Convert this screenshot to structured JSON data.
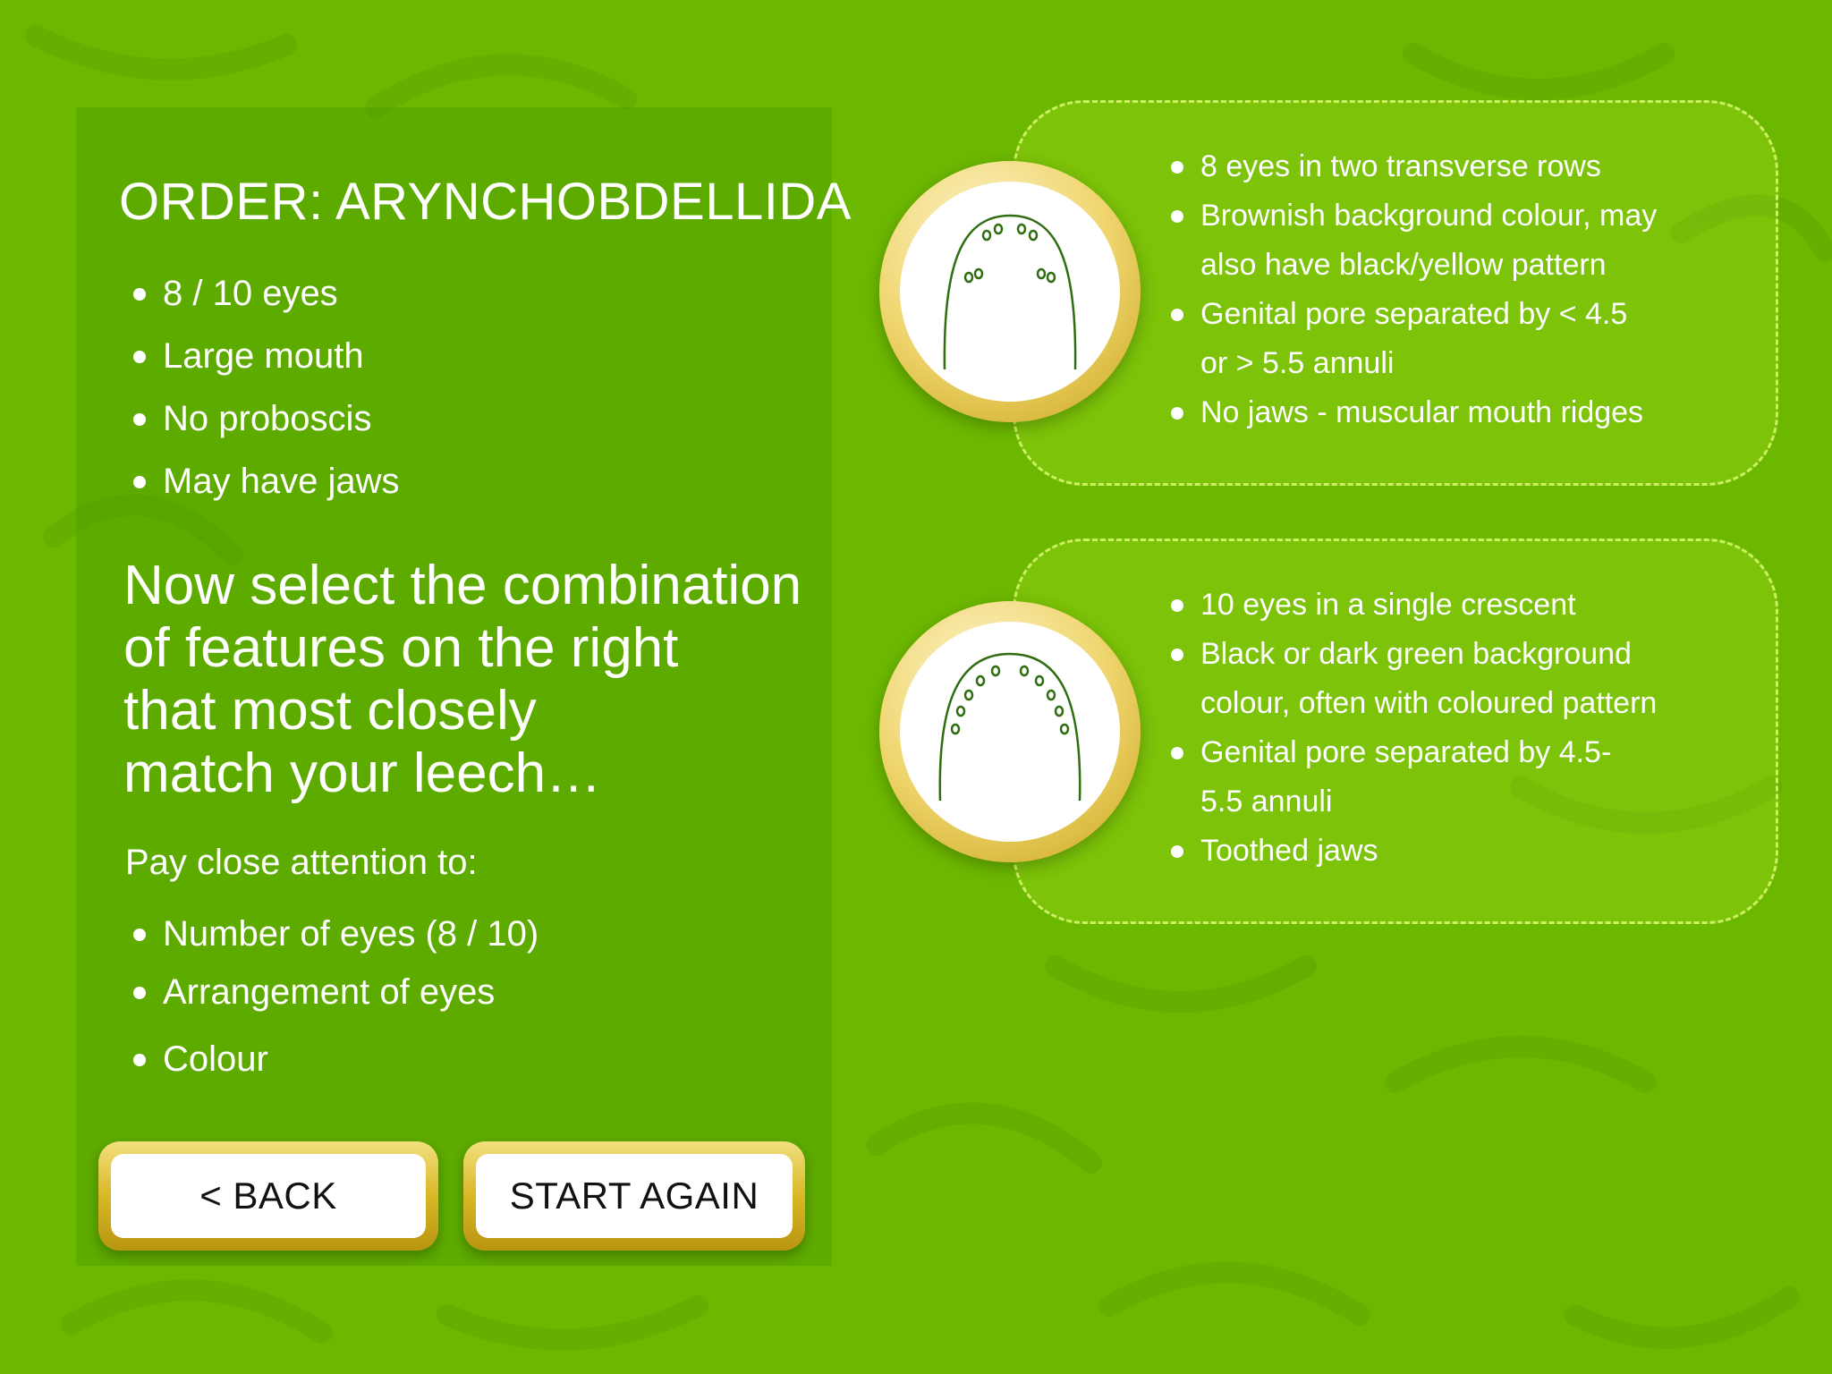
{
  "colors": {
    "background": "#6cb800",
    "left_panel": "#5aa300",
    "text": "#ffffff",
    "button_rim": "#d9b826",
    "button_face": "#ffffff",
    "option_border": "#d4f56e",
    "eye_line": "#2f6e10"
  },
  "order": {
    "title": "ORDER: ARYNCHOBDELLIDA",
    "features": [
      "8 / 10 eyes",
      "Large mouth",
      "No proboscis",
      "May have jaws"
    ]
  },
  "instruction": {
    "lines": [
      "Now select the combination",
      "of features on the right",
      "that most closely",
      "match your leech…"
    ]
  },
  "attention": {
    "label": "Pay close attention to:",
    "items": [
      "Number of eyes (8 / 10)",
      "Arrangement of eyes",
      "Colour"
    ]
  },
  "buttons": {
    "back": "< BACK",
    "start_again": "START AGAIN"
  },
  "options": [
    {
      "icon": "eight-eyes-head-icon",
      "lines": [
        {
          "text": "8 eyes in two transverse rows",
          "bullet": true
        },
        {
          "text": "Brownish background colour, may",
          "bullet": true
        },
        {
          "text": "also have black/yellow pattern",
          "bullet": false
        },
        {
          "text": "Genital pore separated by < 4.5",
          "bullet": true
        },
        {
          "text": "or > 5.5 annuli",
          "bullet": false
        },
        {
          "text": "No jaws - muscular mouth ridges",
          "bullet": true
        }
      ]
    },
    {
      "icon": "ten-eyes-head-icon",
      "lines": [
        {
          "text": "10 eyes in a single crescent",
          "bullet": true
        },
        {
          "text": "Black or dark green background",
          "bullet": true
        },
        {
          "text": "colour, often with coloured pattern",
          "bullet": false
        },
        {
          "text": "Genital pore separated by 4.5-",
          "bullet": true
        },
        {
          "text": "5.5 annuli",
          "bullet": false
        },
        {
          "text": "Toothed jaws",
          "bullet": true
        }
      ]
    }
  ]
}
